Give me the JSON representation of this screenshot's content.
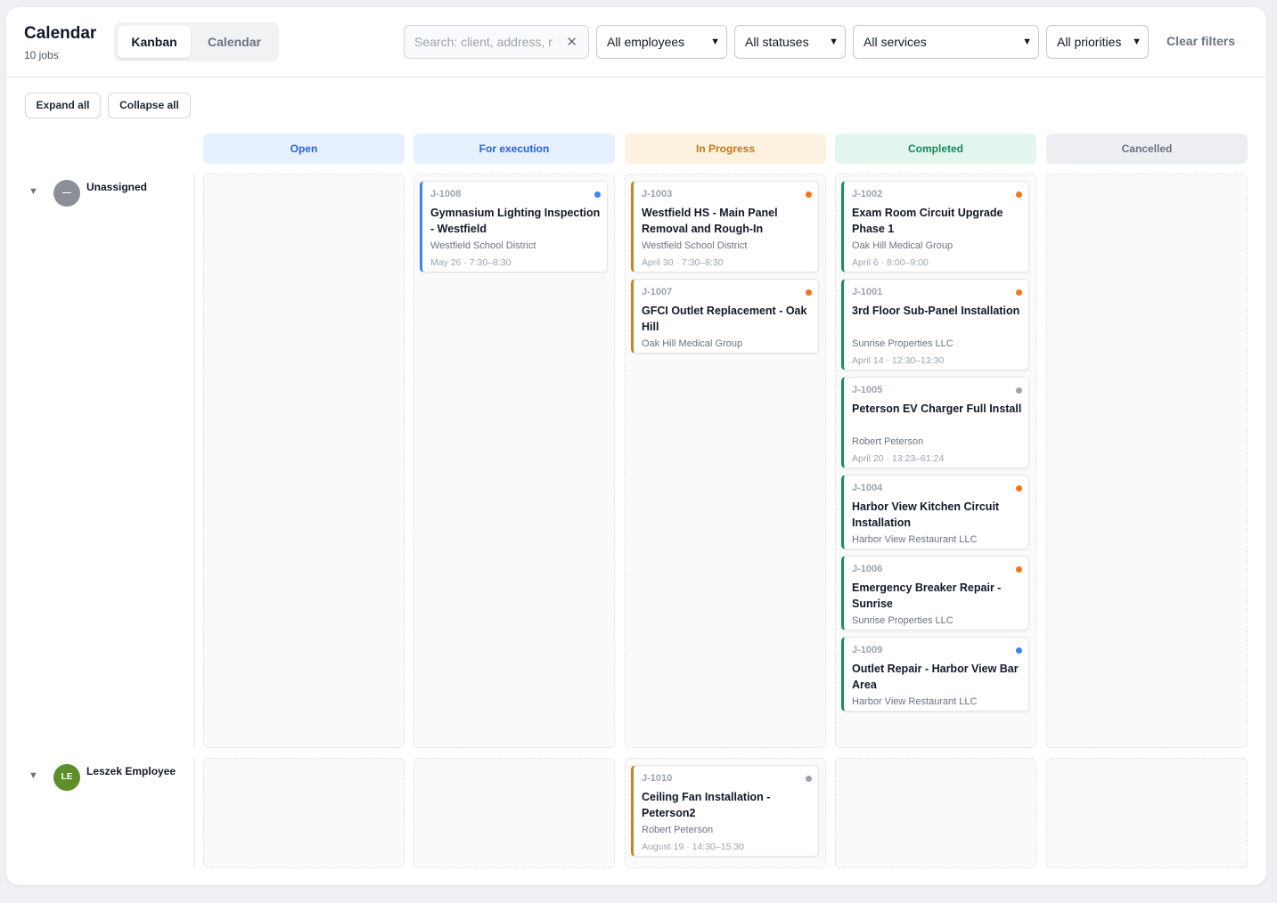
{
  "header": {
    "title": "Calendar",
    "subtitle": "10 jobs",
    "views": [
      "Kanban",
      "Calendar"
    ],
    "active_view": "Kanban"
  },
  "filters": {
    "search_placeholder": "Search: client, address, n",
    "search_value": "",
    "employees": "All employees",
    "statuses": "All statuses",
    "services": "All services",
    "priorities": "All priorities",
    "clear_label": "Clear filters"
  },
  "actions": {
    "expand_all": "Expand all",
    "collapse_all": "Collapse all"
  },
  "columns": [
    {
      "label": "Open",
      "bg": "#e7f0fd",
      "color": "#2563eb"
    },
    {
      "label": "For execution",
      "bg": "#e7f0fd",
      "color": "#2563eb"
    },
    {
      "label": "In Progress",
      "bg": "#fdf1e0",
      "color": "#c17a12"
    },
    {
      "label": "Completed",
      "bg": "#e3f6ee",
      "color": "#0f8a58"
    },
    {
      "label": "Cancelled",
      "bg": "#eceef1",
      "color": "#6b7280"
    }
  ],
  "rows": [
    {
      "name": "Unassigned",
      "avatar_text": "—",
      "avatar_color": "#8b9098",
      "columns": [
        [],
        [
          {
            "id": "J-1008",
            "title": "Gymnasium Lighting Inspection - Westfield",
            "client": "Westfield School District",
            "when": "May 26 · 7:30–8:30",
            "dot": "#3b82f6"
          }
        ],
        [
          {
            "id": "J-1003",
            "title": "Westfield HS - Main Panel Removal and Rough-In",
            "client": "Westfield School District",
            "when": "April 30 · 7:30–8:30",
            "dot": "#f97316"
          },
          {
            "id": "J-1007",
            "title": "GFCI Outlet Replacement - Oak Hill",
            "client": "Oak Hill Medical Group",
            "when": "",
            "dot": "#f97316"
          }
        ],
        [
          {
            "id": "J-1002",
            "title": "Exam Room Circuit Upgrade Phase 1",
            "client": "Oak Hill Medical Group",
            "when": "April 6 · 8:00–9:00",
            "dot": "#f97316"
          },
          {
            "id": "J-1001",
            "title": "3rd Floor Sub-Panel Installation",
            "client": "Sunrise Properties LLC",
            "when": "April 14 · 12:30–13:30",
            "dot": "#f97316"
          },
          {
            "id": "J-1005",
            "title": "Peterson EV Charger Full Install",
            "client": "Robert Peterson",
            "when": "April 20 · 13:23–61:24",
            "dot": "#9ca3af"
          },
          {
            "id": "J-1004",
            "title": "Harbor View Kitchen Circuit Installation",
            "client": "Harbor View Restaurant LLC",
            "when": "",
            "dot": "#f97316"
          },
          {
            "id": "J-1006",
            "title": "Emergency Breaker Repair - Sunrise",
            "client": "Sunrise Properties LLC",
            "when": "",
            "dot": "#f97316"
          },
          {
            "id": "J-1009",
            "title": "Outlet Repair - Harbor View Bar Area",
            "client": "Harbor View Restaurant LLC",
            "when": "",
            "dot": "#3b82f6"
          }
        ],
        []
      ]
    },
    {
      "name": "Leszek Employee",
      "avatar_text": "LE",
      "avatar_color": "#5c8f2a",
      "columns": [
        [],
        [],
        [
          {
            "id": "J-1010",
            "title": "Ceiling Fan Installation - Peterson2",
            "client": "Robert Peterson",
            "when": "August 19 · 14:30–15:30",
            "dot": "#9ca3af"
          }
        ],
        [],
        []
      ]
    }
  ]
}
